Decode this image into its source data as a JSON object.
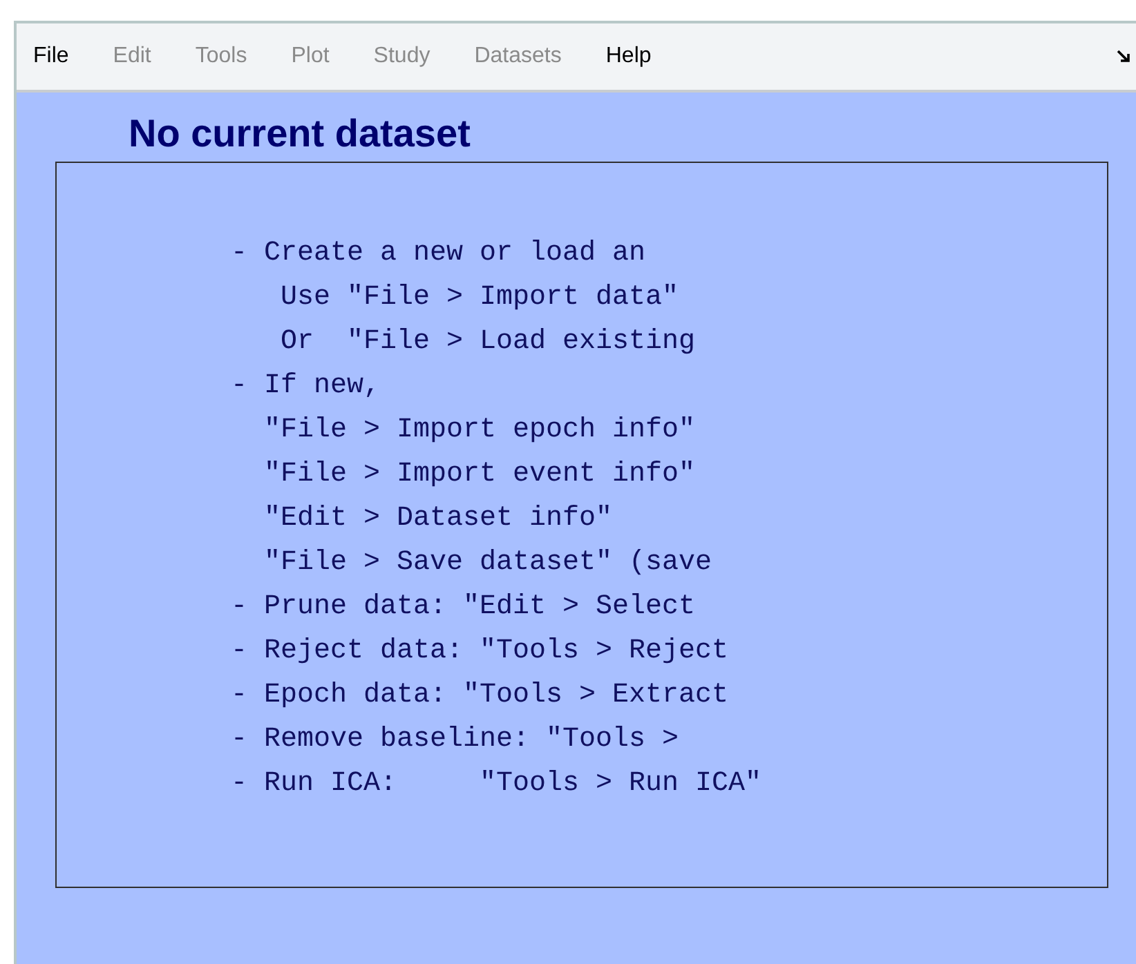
{
  "menu": [
    {
      "label": "File",
      "disabled": false
    },
    {
      "label": "Edit",
      "disabled": true
    },
    {
      "label": "Tools",
      "disabled": true
    },
    {
      "label": "Plot",
      "disabled": true
    },
    {
      "label": "Study",
      "disabled": true
    },
    {
      "label": "Datasets",
      "disabled": true
    },
    {
      "label": "Help",
      "disabled": false
    }
  ],
  "panel": {
    "title": "No current dataset",
    "lines": [
      "- Create a new or load an",
      "   Use \"File > Import data\"",
      "   Or  \"File > Load existing",
      "- If new,",
      "  \"File > Import epoch info\"",
      "  \"File > Import event info\"",
      "  \"Edit > Dataset info\"",
      "  \"File > Save dataset\" (save",
      "- Prune data: \"Edit > Select",
      "- Reject data: \"Tools > Reject",
      "- Epoch data: \"Tools > Extract",
      "- Remove baseline: \"Tools >",
      "- Run ICA:     \"Tools > Run ICA\""
    ]
  }
}
